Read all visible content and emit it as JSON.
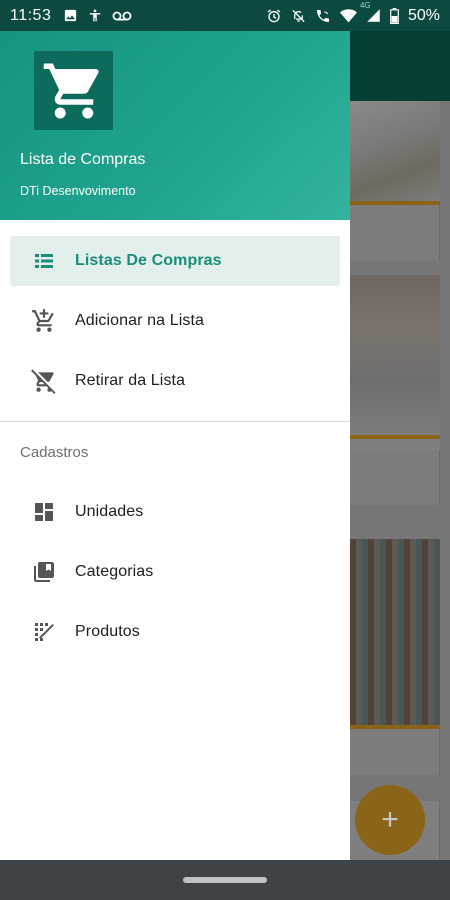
{
  "status_bar": {
    "time": "11:53",
    "battery": "50%",
    "network": "4G",
    "left_icons": [
      "image-icon",
      "accessibility-icon",
      "voicemail-icon"
    ],
    "right_icons": [
      "alarm-icon",
      "notifications-off-icon",
      "wifi-call-icon",
      "wifi-icon",
      "signal-icon",
      "battery-icon"
    ]
  },
  "drawer": {
    "header": {
      "title": "Lista de Compras",
      "subtitle": "DTi Desenvovimento",
      "logo_icon": "shopping-cart-icon",
      "gradient_start": "#17947f",
      "gradient_end": "#34b39e"
    },
    "items": [
      {
        "label": "Listas De Compras",
        "icon": "list-icon",
        "active": true
      },
      {
        "label": "Adicionar na Lista",
        "icon": "add-cart-icon",
        "active": false
      },
      {
        "label": "Retirar da Lista",
        "icon": "remove-cart-icon",
        "active": false
      }
    ],
    "section_title": "Cadastros",
    "section_items": [
      {
        "label": "Unidades",
        "icon": "dashboard-icon"
      },
      {
        "label": "Categorias",
        "icon": "library-icon"
      },
      {
        "label": "Produtos",
        "icon": "barcode-icon"
      }
    ],
    "accent_color": "#1a8e7b"
  },
  "background_app": {
    "fab_label": "+",
    "fab_color": "#f5b42b"
  }
}
